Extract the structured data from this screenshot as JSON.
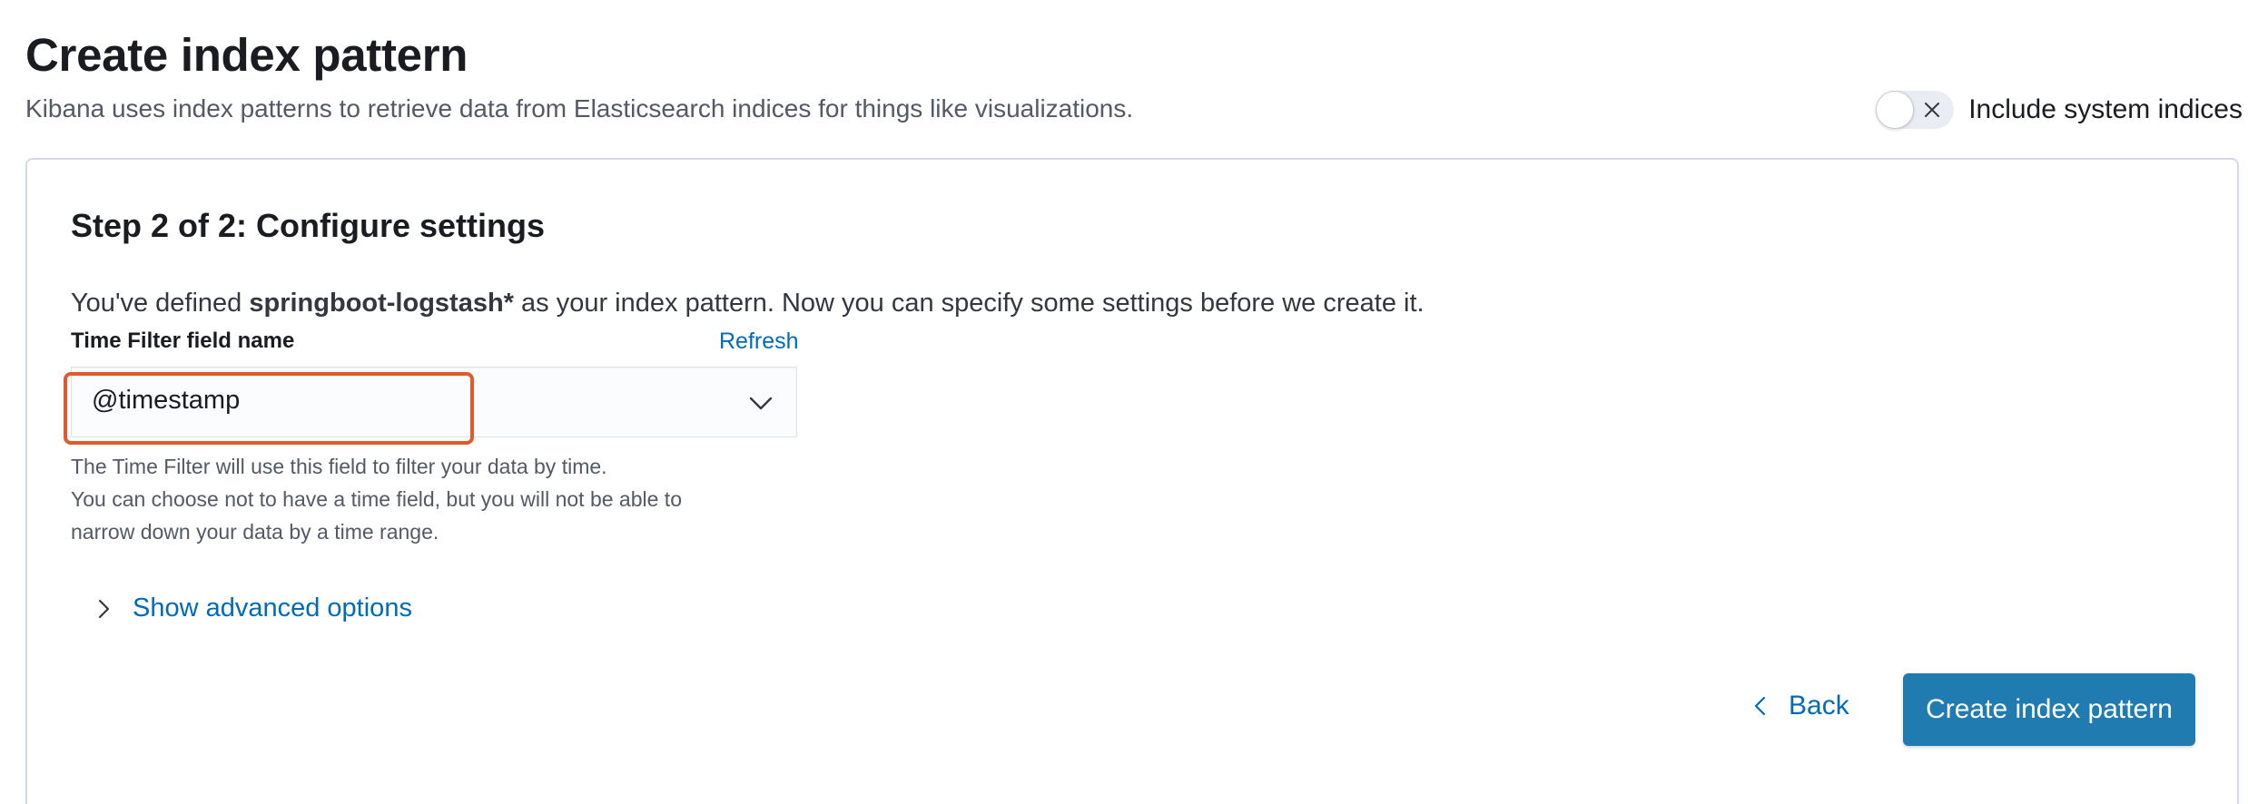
{
  "header": {
    "title": "Create index pattern",
    "subtitle": "Kibana uses index patterns to retrieve data from Elasticsearch indices for things like visualizations."
  },
  "system_indices": {
    "label": "Include system indices",
    "checked": false,
    "icon": "close-icon"
  },
  "step": {
    "title": "Step 2 of 2: Configure settings",
    "defined_prefix": "You've defined ",
    "index_pattern": "springboot-logstash*",
    "defined_suffix": " as your index pattern. Now you can specify some settings before we create it."
  },
  "time_filter": {
    "label": "Time Filter field name",
    "refresh_label": "Refresh",
    "selected_value": "@timestamp",
    "help_lines": [
      "The Time Filter will use this field to filter your data by time.",
      "You can choose not to have a time field, but you will not be able to",
      "narrow down your data by a time range."
    ]
  },
  "advanced": {
    "label": "Show advanced options",
    "icon": "chevron-right-icon"
  },
  "actions": {
    "back_label": "Back",
    "back_icon": "chevron-left-icon",
    "create_label": "Create index pattern"
  },
  "colors": {
    "accent": "#207bb0",
    "link": "#006bb8",
    "highlight": "#e05a2b"
  }
}
